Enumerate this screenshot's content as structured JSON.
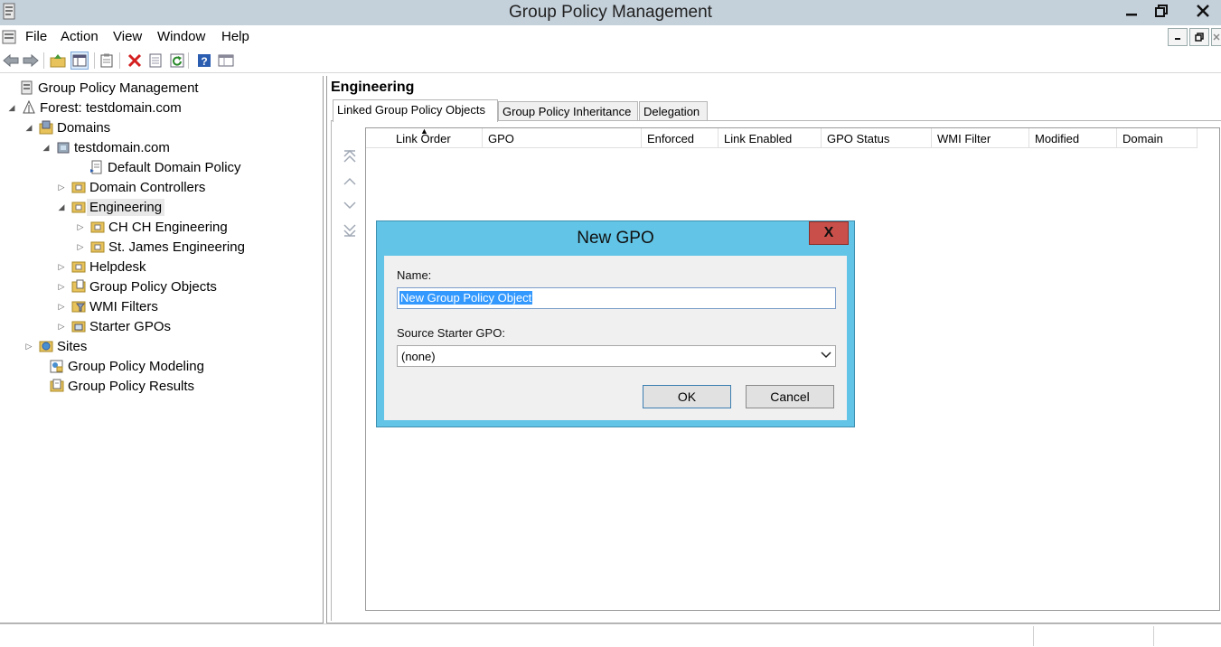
{
  "window": {
    "title": "Group Policy Management",
    "minimize_glyph": "–",
    "restore_glyph": "❐",
    "close_glyph": "✕"
  },
  "menu": {
    "items": [
      "File",
      "Action",
      "View",
      "Window",
      "Help"
    ]
  },
  "toolbar": {
    "buttons": [
      "back-icon",
      "forward-icon",
      "up-folder-icon",
      "show-hide-console-tree-icon",
      "clipboard-icon",
      "delete-icon",
      "properties-icon",
      "refresh-icon",
      "help-icon",
      "console-view-icon"
    ]
  },
  "tree": {
    "items": [
      {
        "label": "Group Policy Management",
        "icon": "gpm-root-icon",
        "expander": ""
      },
      {
        "label": "Forest: testdomain.com",
        "icon": "forest-icon",
        "expander": "◢"
      },
      {
        "label": "Domains",
        "icon": "domains-icon",
        "expander": "◢"
      },
      {
        "label": "testdomain.com",
        "icon": "domain-icon",
        "expander": "◢"
      },
      {
        "label": "Default Domain Policy",
        "icon": "gpo-link-icon",
        "expander": ""
      },
      {
        "label": "Domain Controllers",
        "icon": "ou-folder-icon",
        "expander": "▷"
      },
      {
        "label": "Engineering",
        "icon": "ou-folder-icon",
        "expander": "◢"
      },
      {
        "label": "CH CH Engineering",
        "icon": "ou-folder-icon",
        "expander": "▷"
      },
      {
        "label": "St. James Engineering",
        "icon": "ou-folder-icon",
        "expander": "▷"
      },
      {
        "label": "Helpdesk",
        "icon": "ou-folder-icon",
        "expander": "▷"
      },
      {
        "label": "Group Policy Objects",
        "icon": "gpo-container-icon",
        "expander": "▷"
      },
      {
        "label": "WMI Filters",
        "icon": "wmi-filter-icon",
        "expander": "▷"
      },
      {
        "label": "Starter GPOs",
        "icon": "starter-gpo-icon",
        "expander": "▷"
      },
      {
        "label": "Sites",
        "icon": "sites-icon",
        "expander": "▷"
      },
      {
        "label": "Group Policy Modeling",
        "icon": "modeling-icon",
        "expander": ""
      },
      {
        "label": "Group Policy Results",
        "icon": "results-icon",
        "expander": ""
      }
    ]
  },
  "right_pane": {
    "title": "Engineering",
    "tabs": [
      "Linked Group Policy Objects",
      "Group Policy Inheritance",
      "Delegation"
    ],
    "active_tab": "Linked Group Policy Objects",
    "columns": [
      "Link Order",
      "GPO",
      "Enforced",
      "Link Enabled",
      "GPO Status",
      "WMI Filter",
      "Modified",
      "Domain"
    ],
    "sort_indicator": "▲"
  },
  "dialog": {
    "title": "New GPO",
    "close_glyph": "X",
    "name_label": "Name:",
    "name_value": "New Group Policy Object",
    "source_label": "Source Starter GPO:",
    "source_value": "(none)",
    "ok_label": "OK",
    "cancel_label": "Cancel"
  },
  "colors": {
    "titlebar": "#c4d0da",
    "dialog_frame": "#62c4e6",
    "dialog_close": "#c9504a",
    "selection": "#3399ff"
  }
}
